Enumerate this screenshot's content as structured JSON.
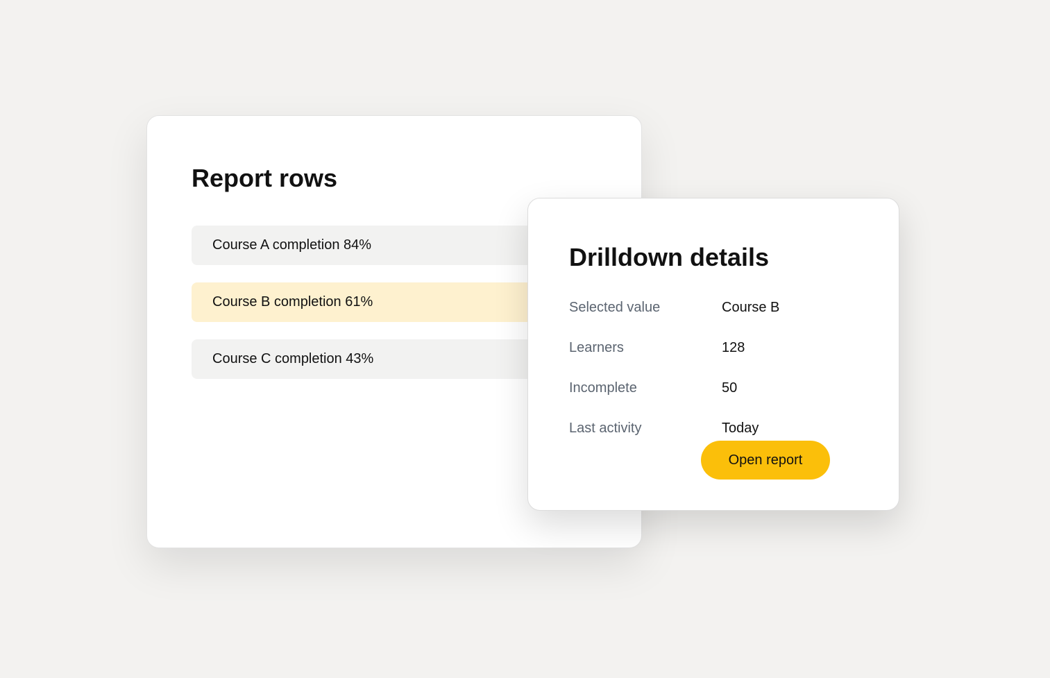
{
  "report": {
    "title": "Report rows",
    "rows": [
      {
        "label": "Course A completion 84%",
        "selected": false
      },
      {
        "label": "Course B completion 61%",
        "selected": true
      },
      {
        "label": "Course C completion 43%",
        "selected": false
      }
    ]
  },
  "drilldown": {
    "title": "Drilldown details",
    "details": [
      {
        "label": "Selected value",
        "value": "Course B"
      },
      {
        "label": "Learners",
        "value": "128"
      },
      {
        "label": "Incomplete",
        "value": "50"
      },
      {
        "label": "Last activity",
        "value": "Today"
      }
    ],
    "open_button_label": "Open report"
  },
  "colors": {
    "background": "#f3f2f0",
    "row_default": "#f2f2f1",
    "row_selected": "#fef1cf",
    "accent": "#fbbf0a",
    "label_muted": "#5b6470"
  }
}
